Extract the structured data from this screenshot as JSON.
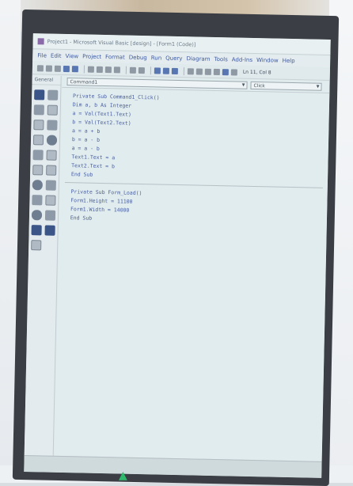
{
  "window": {
    "title": "Project1 - Microsoft Visual Basic [design] - [Form1 (Code)]"
  },
  "menubar": {
    "items": [
      "File",
      "Edit",
      "View",
      "Project",
      "Format",
      "Debug",
      "Run",
      "Query",
      "Diagram",
      "Tools",
      "Add-Ins",
      "Window",
      "Help"
    ]
  },
  "toolbar": {
    "position_readout": "Ln 11, Col 8"
  },
  "toolbox": {
    "header": "General"
  },
  "code_window": {
    "object_combo": "Command1",
    "procedure_combo": "Click",
    "lines_block1": [
      "  Private Sub Command1_Click()",
      "  Dim a, b As Integer",
      "  a = Val(Text1.Text)",
      "  b = Val(Text2.Text)",
      "  a = a + b",
      "  b = a - b",
      "  a = a - b",
      "  Text1.Text = a",
      "  Text2.Text = b",
      "  End Sub"
    ],
    "lines_block2": [
      "  Private Sub Form_Load()",
      "  Form1.Height = 11100",
      "  Form1.Width = 14000",
      "  End Sub"
    ]
  },
  "colors": {
    "code_text": "#4a60a2",
    "screen_bg": "#dfeaec",
    "bezel": "#3b3f45"
  }
}
